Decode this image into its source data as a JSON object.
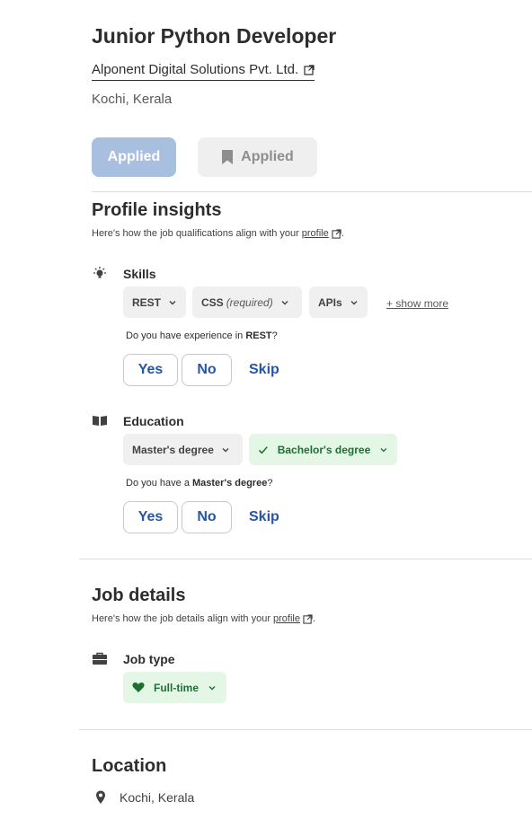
{
  "job": {
    "title": "Junior Python Developer",
    "company": "Alponent Digital Solutions Pvt. Ltd.",
    "location": "Kochi, Kerala"
  },
  "actions": {
    "applied_button": "Applied",
    "saved_button": "Applied"
  },
  "profile_insights": {
    "title": "Profile insights",
    "subtitle_prefix": "Here's how the job qualifications align with your",
    "profile_link": "profile",
    "subtitle_suffix": ".",
    "skills": {
      "label": "Skills",
      "chips": [
        {
          "label": "REST",
          "note": ""
        },
        {
          "label": "CSS",
          "note": "(required)"
        },
        {
          "label": "APIs",
          "note": ""
        }
      ],
      "show_more": "+ show more",
      "question_prefix": "Do you have experience in",
      "question_term": "REST",
      "question_suffix": "?",
      "yes": "Yes",
      "no": "No",
      "skip": "Skip"
    },
    "education": {
      "label": "Education",
      "chips": [
        {
          "label": "Master's degree",
          "matched": false
        },
        {
          "label": "Bachelor's degree",
          "matched": true
        }
      ],
      "question_prefix": "Do you have a",
      "question_term": "Master's degree",
      "question_suffix": "?",
      "yes": "Yes",
      "no": "No",
      "skip": "Skip"
    }
  },
  "job_details": {
    "title": "Job details",
    "subtitle_prefix": "Here's how the job details align with your",
    "profile_link": "profile",
    "subtitle_suffix": ".",
    "job_type": {
      "label": "Job type",
      "chip": "Full-time"
    }
  },
  "location_section": {
    "title": "Location",
    "value": "Kochi, Kerala"
  },
  "colors": {
    "primary_blue": "#2557a7",
    "applied_disabled": "#a8bfe0",
    "match_green_bg": "#e4f7e7",
    "match_green_text": "#1f6f33"
  }
}
